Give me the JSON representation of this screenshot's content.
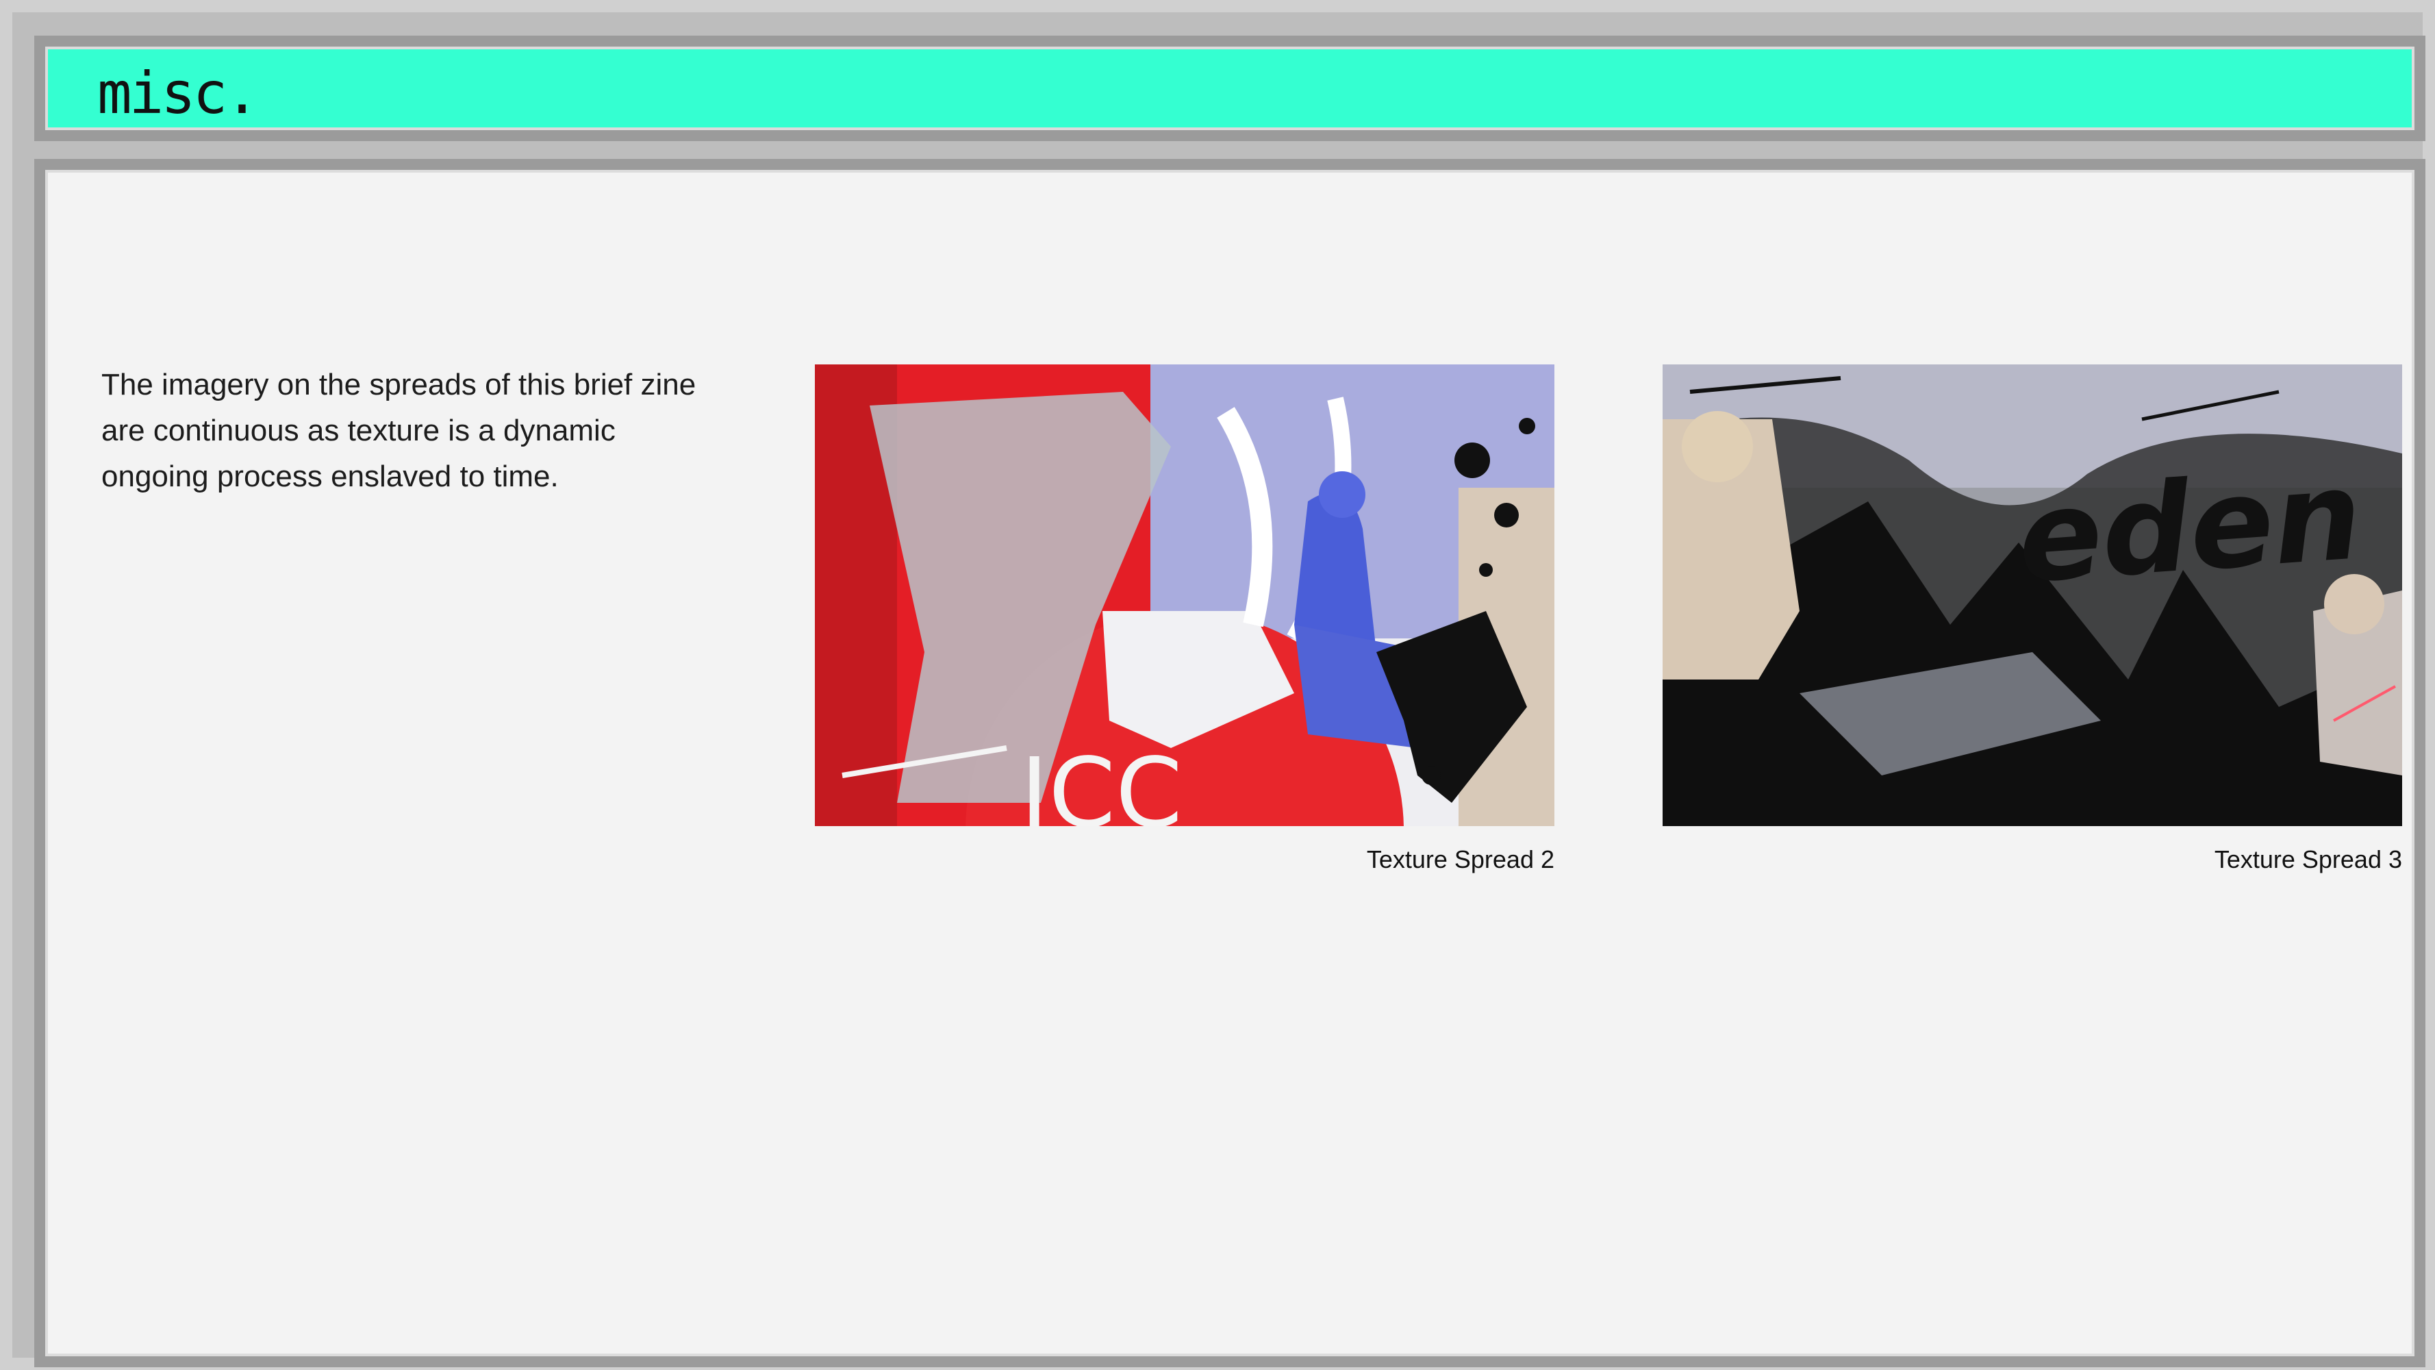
{
  "window": {
    "title": "misc.",
    "accent_color": "#34ffd1"
  },
  "main": {
    "description": "The imagery on the spreads of this brief zine are continuous as texture is a dynamic ongoing process enslaved to time.",
    "gallery": [
      {
        "caption": "Texture Spread 2",
        "image": "collage-red-blue-figure"
      },
      {
        "caption": "Texture Spread 3",
        "image": "collage-monochrome-eden",
        "overlay_text": "eden"
      }
    ]
  }
}
